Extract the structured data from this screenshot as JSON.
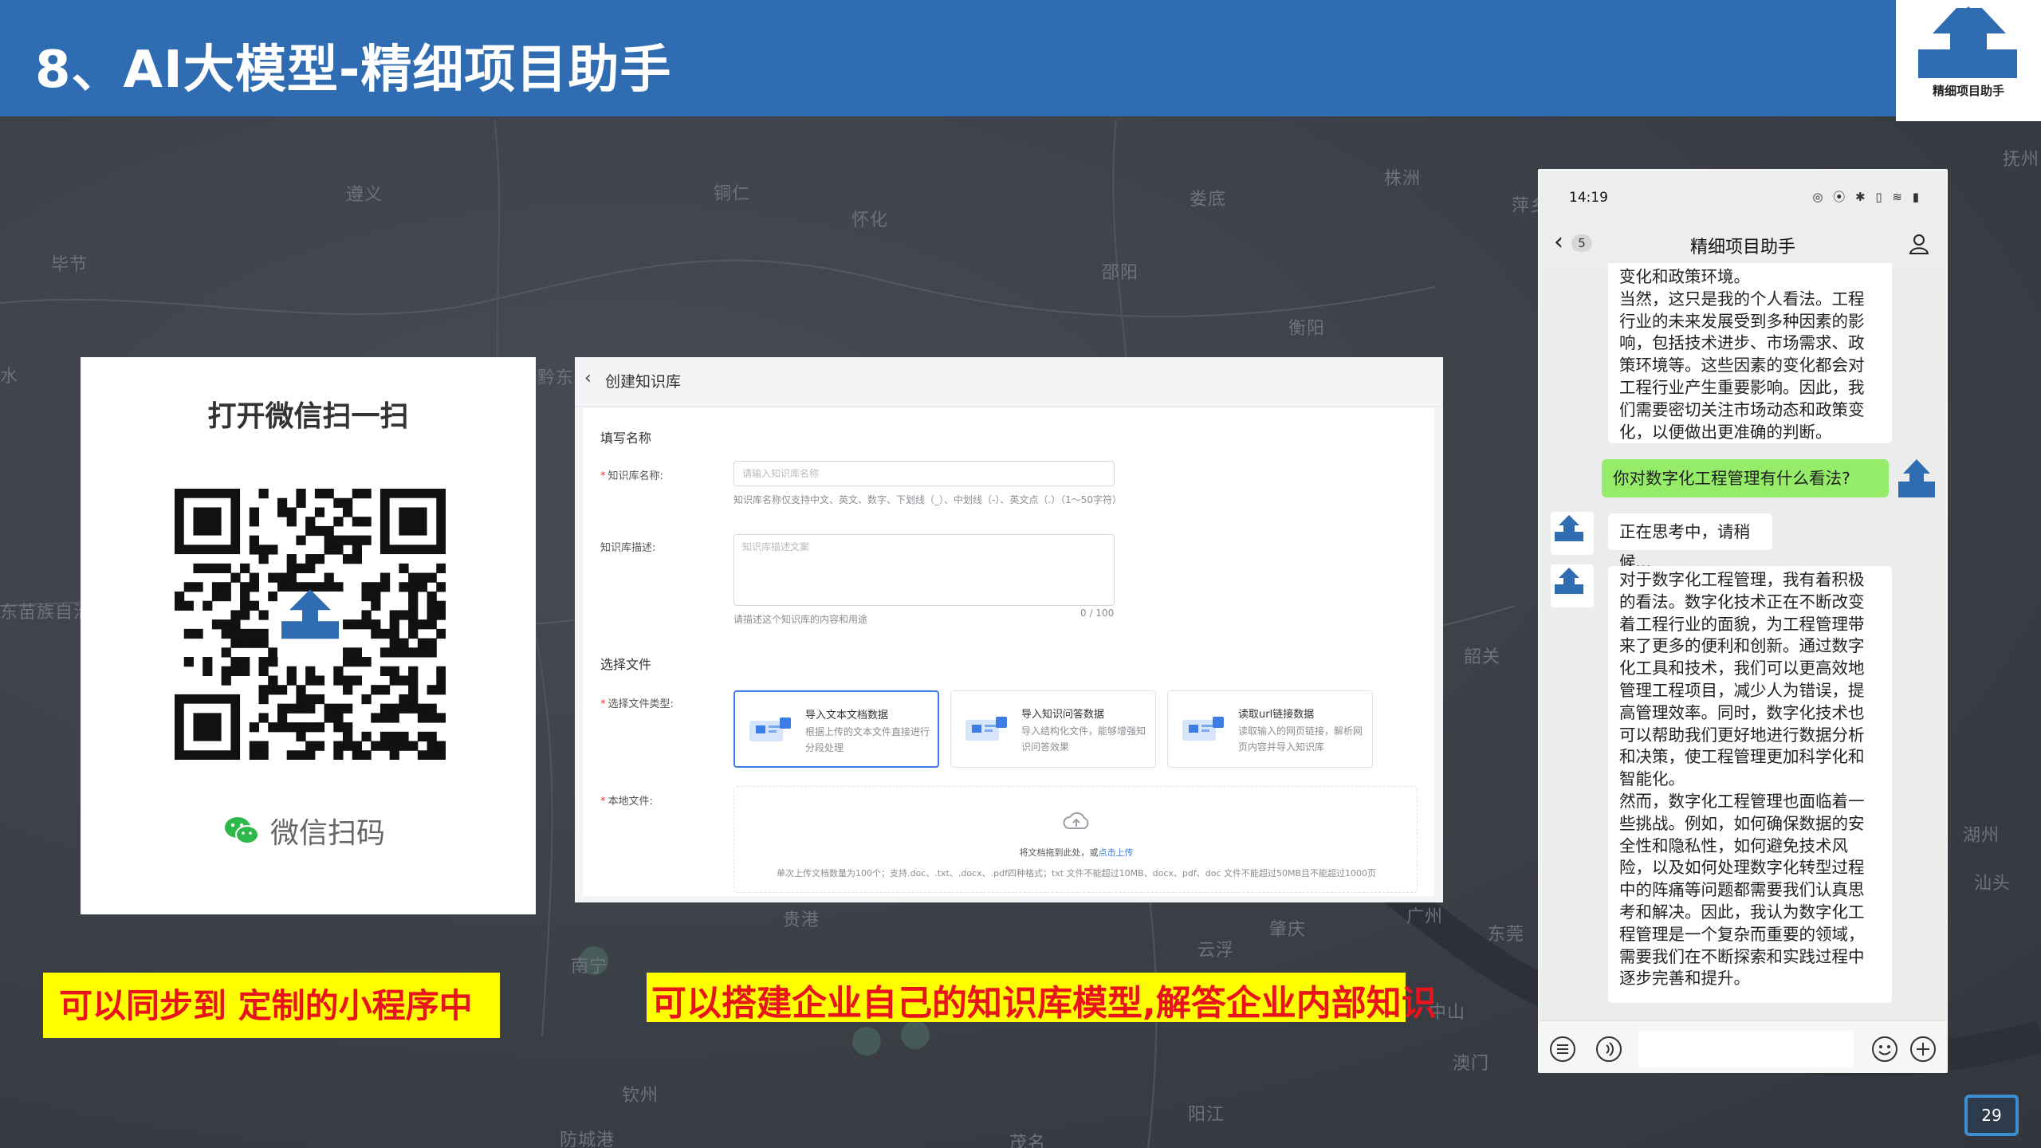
{
  "slide": {
    "title": "8、AI大模型-精细项目助手",
    "page_number": "29",
    "logo_text": "精细项目助手"
  },
  "map_labels": [
    "遵义",
    "铜仁",
    "怀化",
    "株洲",
    "娄底",
    "萍乡",
    "抚州",
    "毕节",
    "邵阳",
    "衡阳",
    "水",
    "黔东南",
    "东苗族自治州",
    "韶关",
    "湖州",
    "汕头",
    "贵港",
    "南宁",
    "云浮",
    "肇庆",
    "广州",
    "东莞",
    "中山",
    "澳门",
    "钦州",
    "防城港",
    "阳江",
    "茂名"
  ],
  "qr_panel": {
    "title": "打开微信扫一扫",
    "bottom_label": "微信扫码"
  },
  "kb_form": {
    "back_icon": "chevron-left-icon",
    "page_title": "创建知识库",
    "section1_title": "填写名称",
    "name_label": "知识库名称:",
    "name_placeholder": "请输入知识库名称",
    "name_hint": "知识库名称仅支持中文、英文、数字、下划线（_）、中划线（-）、英文点（.）（1～50字符）",
    "desc_label": "知识库描述:",
    "desc_placeholder": "知识库描述文案",
    "desc_hint": "请描述这个知识库的内容和用途",
    "desc_counter": "0 / 100",
    "section2_title": "选择文件",
    "type_label": "选择文件类型:",
    "types": [
      {
        "title": "导入文本文档数据",
        "desc": "根据上传的文本文件直接进行分段处理",
        "active": true
      },
      {
        "title": "导入知识问答数据",
        "desc": "导入结构化文件，能够增强知识问答效果",
        "active": false
      },
      {
        "title": "读取url链接数据",
        "desc": "读取输入的网页链接，解析网页内容并导入知识库",
        "active": false
      }
    ],
    "file_label": "本地文件:",
    "upload_text": "将文档拖到此处，或",
    "upload_link": "点击上传",
    "upload_hint": "单次上传文档数量为100个；支持.doc、.txt、.docx、.pdf四种格式；txt 文件不能超过10MB、docx、pdf、doc 文件不能超过50MB且不能超过1000页"
  },
  "captions": {
    "left": "可以同步到 定制的小程序中",
    "right": "可以搭建企业自己的知识库模型,解答企业内部知识"
  },
  "phone": {
    "time": "14:19",
    "status_icons": "◎ ⦿ ✱ ▯ ≋ ▮",
    "back_badge": "5",
    "chat_title": "精细项目助手",
    "messages": [
      {
        "from": "bot",
        "text": "变化和政策环境。\n当然，这只是我的个人看法。工程\n行业的未来发展受到多种因素的影\n响，包括技术进步、市场需求、政\n策环境等。这些因素的变化都会对\n工程行业产生重要影响。因此，我\n们需要密切关注市场动态和政策变\n化，以便做出更准确的判断。"
      },
      {
        "from": "me",
        "text": "你对数字化工程管理有什么看法?"
      },
      {
        "from": "bot",
        "text": "正在思考中，请稍候..."
      },
      {
        "from": "bot",
        "text": "对于数字化工程管理，我有着积极\n的看法。数字化技术正在不断改变\n着工程行业的面貌，为工程管理带\n来了更多的便利和创新。通过数字\n化工具和技术，我们可以更高效地\n管理工程项目，减少人为错误，提\n高管理效率。同时，数字化技术也\n可以帮助我们更好地进行数据分析\n和决策，使工程管理更加科学化和\n智能化。\n然而，数字化工程管理也面临着一\n些挑战。例如，如何确保数据的安\n全性和隐私性，如何避免技术风\n险，以及如何处理数字化转型过程\n中的阵痛等问题都需要我们认真思\n考和解决。因此，我认为数字化工\n程管理是一个复杂而重要的领域，\n需要我们在不断探索和实践过程中\n逐步完善和提升。"
      }
    ]
  },
  "colors": {
    "header": "#2f6cb2",
    "caption_bg": "#ffff00",
    "caption_text": "#e8141b",
    "wechat_green": "#95ec69",
    "accent_blue": "#3d7ee6"
  }
}
